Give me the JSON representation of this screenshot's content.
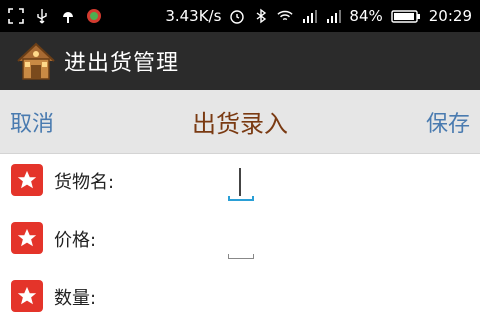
{
  "status_bar": {
    "network_speed": "3.43K/s",
    "battery_percent": "84%",
    "time": "20:29",
    "icons": [
      "screenshot-icon",
      "usb-icon",
      "android-debug-icon",
      "app-notification-icon",
      "alarm-icon",
      "bluetooth-icon",
      "wifi-icon",
      "signal-icon",
      "signal-icon-2",
      "battery-icon"
    ]
  },
  "action_bar": {
    "title": "进出货管理",
    "icon": "house-icon"
  },
  "nav_bar": {
    "cancel_label": "取消",
    "title": "出货录入",
    "save_label": "保存"
  },
  "form": {
    "fields": [
      {
        "label": "货物名:",
        "value": "",
        "required": true,
        "active": true
      },
      {
        "label": "价格:",
        "value": "",
        "required": true,
        "active": false
      },
      {
        "label": "数量:",
        "value": "",
        "required": true,
        "active": false
      }
    ]
  },
  "colors": {
    "status_bar_bg": "#000000",
    "action_bar_bg": "#2b2b2b",
    "nav_bar_bg": "#e6e6e6",
    "nav_button_text": "#4a7bb0",
    "nav_title_text": "#7a3a12",
    "required_badge": "#e4342a",
    "focus_underline": "#2a9fd6"
  }
}
